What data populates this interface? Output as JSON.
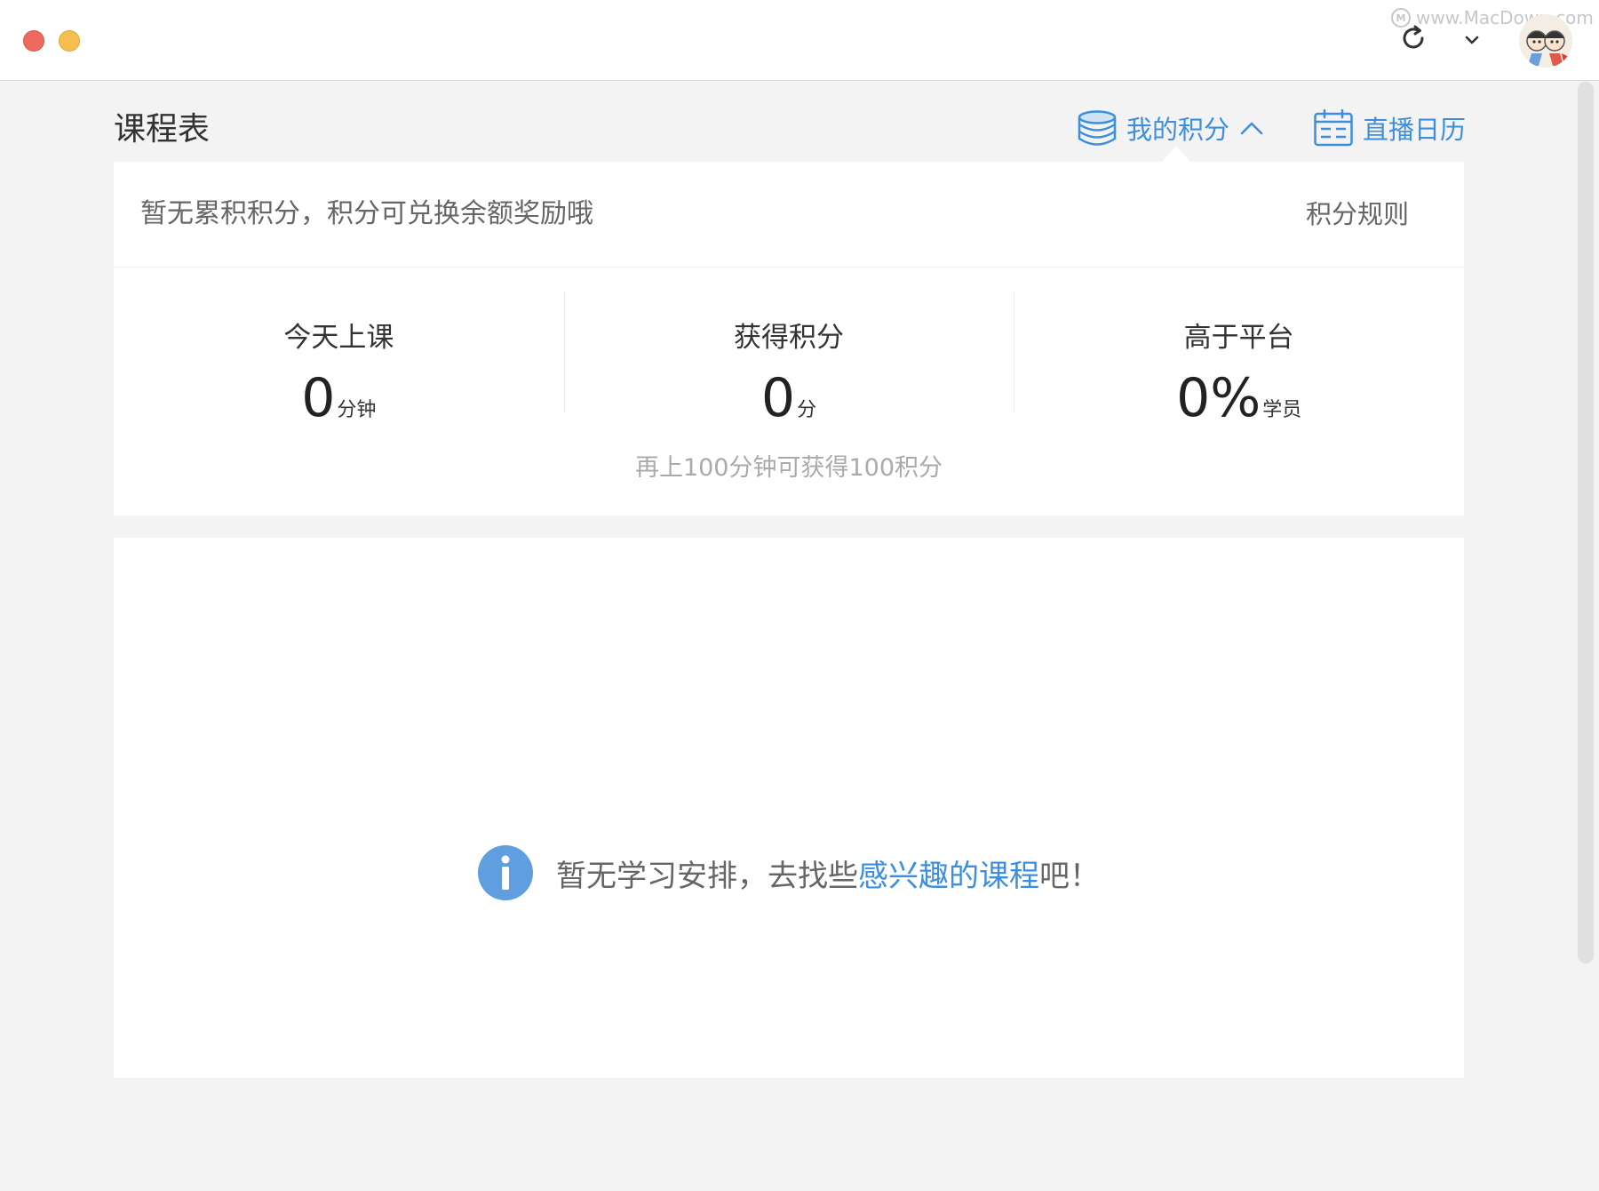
{
  "watermark": "www.MacDown.com",
  "page_title": "课程表",
  "header_links": {
    "my_points": "我的积分",
    "live_calendar": "直播日历"
  },
  "points_panel": {
    "message": "暂无累积积分，积分可兑换余额奖励哦",
    "rules_link": "积分规则",
    "stats": [
      {
        "label": "今天上课",
        "value": "0",
        "unit": "分钟"
      },
      {
        "label": "获得积分",
        "value": "0",
        "unit": "分"
      },
      {
        "label": "高于平台",
        "value": "0%",
        "unit": "学员"
      }
    ],
    "hint": "再上100分钟可获得100积分"
  },
  "schedule": {
    "empty_prefix": "暂无学习安排，去找些",
    "empty_link": "感兴趣的课程",
    "empty_suffix": "吧！"
  },
  "colors": {
    "accent": "#3d8fde",
    "close": "#ee6a5e",
    "minimize": "#f5be4f"
  }
}
